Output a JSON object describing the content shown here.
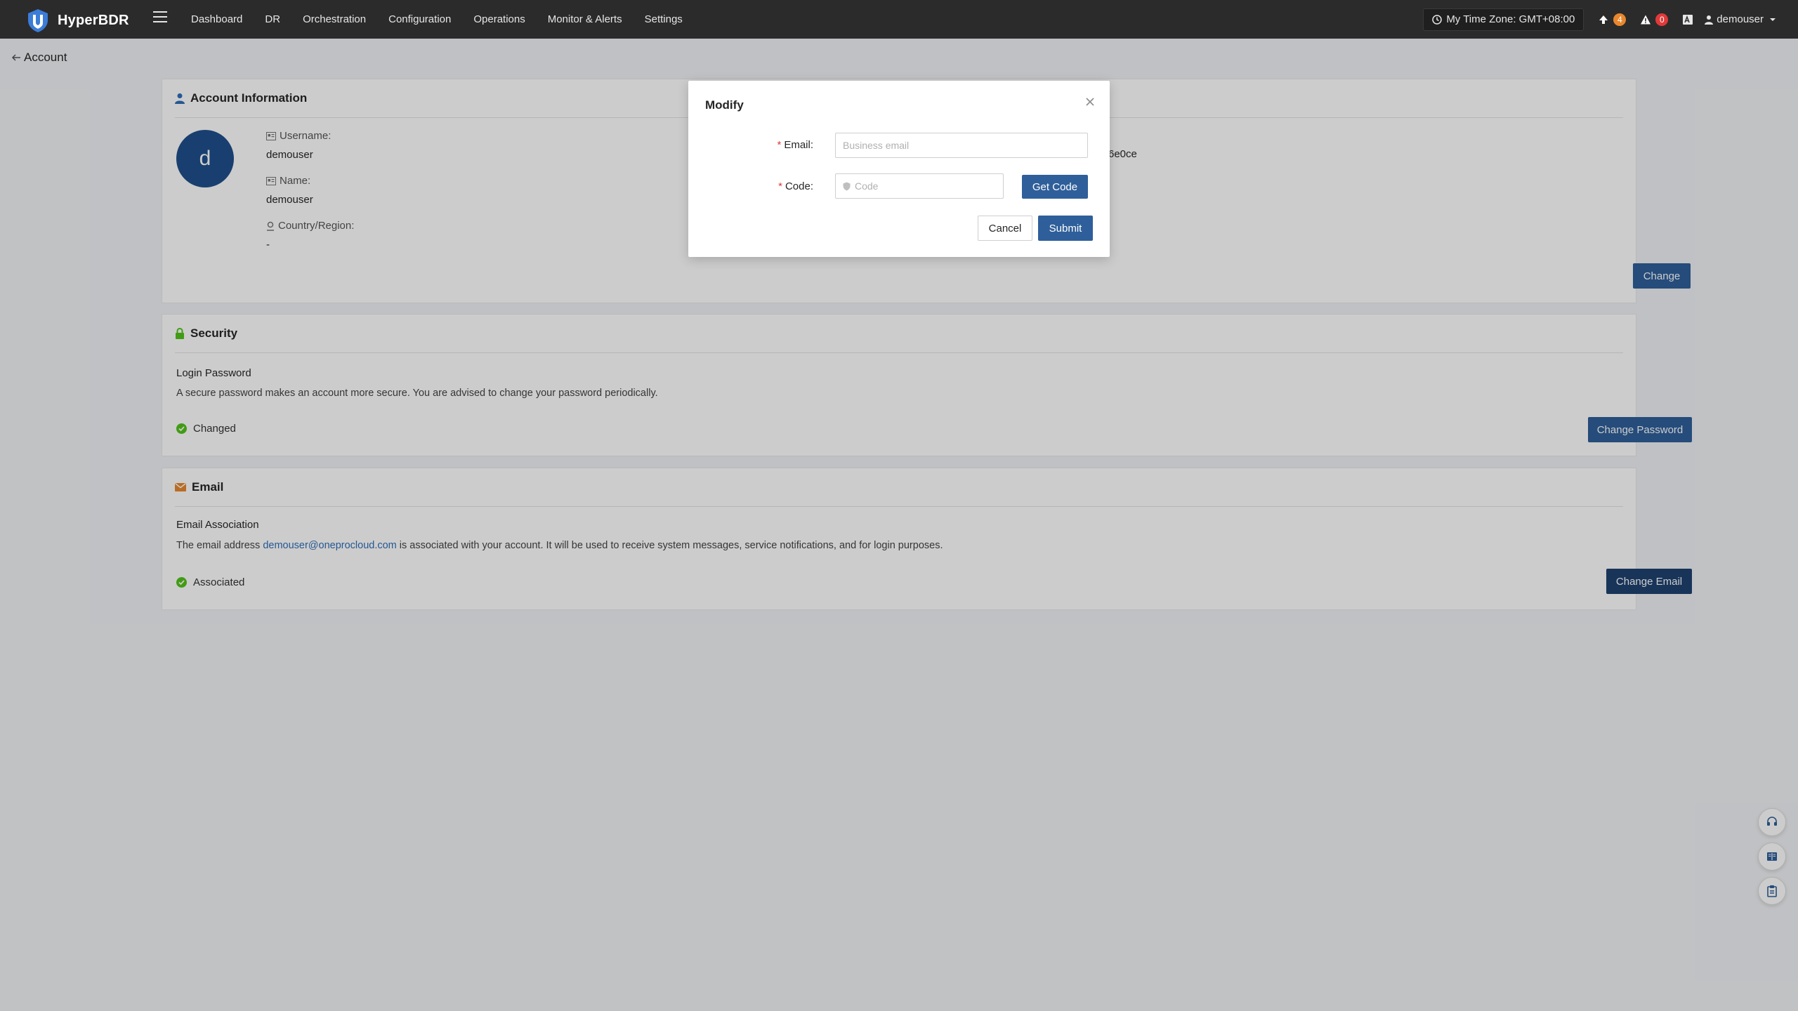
{
  "app": {
    "brand": "HyperBDR"
  },
  "nav": {
    "items": [
      "Dashboard",
      "DR",
      "Orchestration",
      "Configuration",
      "Operations",
      "Monitor & Alerts",
      "Settings"
    ],
    "timezone": "My Time Zone: GMT+08:00",
    "upload_count": "4",
    "alert_count": "0",
    "user": "demouser"
  },
  "page": {
    "back_label": "Account"
  },
  "account_info": {
    "title": "Account Information",
    "avatar_letter": "d",
    "username_label": "Username:",
    "username": "demouser",
    "name_label": "Name:",
    "name": "demouser",
    "country_label": "Country/Region:",
    "country": "-",
    "partial_id": "6e0ce",
    "change_label": "Change"
  },
  "security": {
    "title": "Security",
    "heading": "Login Password",
    "description": "A secure password makes an account more secure. You are advised to change your password periodically.",
    "status": "Changed",
    "button": "Change Password"
  },
  "email": {
    "title": "Email",
    "heading": "Email Association",
    "desc_before": "The email address ",
    "address": "demouser@oneprocloud.com",
    "desc_after": " is associated with your account. It will be used to receive system messages, service notifications, and for login purposes.",
    "status": "Associated",
    "button": "Change Email"
  },
  "modal": {
    "title": "Modify",
    "email_label": "Email:",
    "email_placeholder": "Business email",
    "code_label": "Code:",
    "code_placeholder": "Code",
    "get_code": "Get Code",
    "cancel": "Cancel",
    "submit": "Submit"
  },
  "icons": {
    "brand": "shield-logo-icon",
    "menu": "hamburger-icon",
    "clock": "clock-icon",
    "upload": "upload-icon",
    "alert": "warning-icon",
    "language": "language-icon",
    "user": "user-icon",
    "dropdown": "caret-down-icon",
    "back": "arrow-left-icon",
    "account": "user-icon",
    "lock": "lock-icon",
    "mail": "mail-icon",
    "check": "check-circle-icon",
    "close": "close-icon",
    "float": [
      "headset-icon",
      "book-icon",
      "clipboard-icon"
    ]
  },
  "colors": {
    "nav_bg": "#2b2b2b",
    "primary": "#2f5f9a",
    "success": "#52c41a",
    "danger": "#e03a3a",
    "warning": "#e8872d",
    "link": "#2f6fb8"
  }
}
